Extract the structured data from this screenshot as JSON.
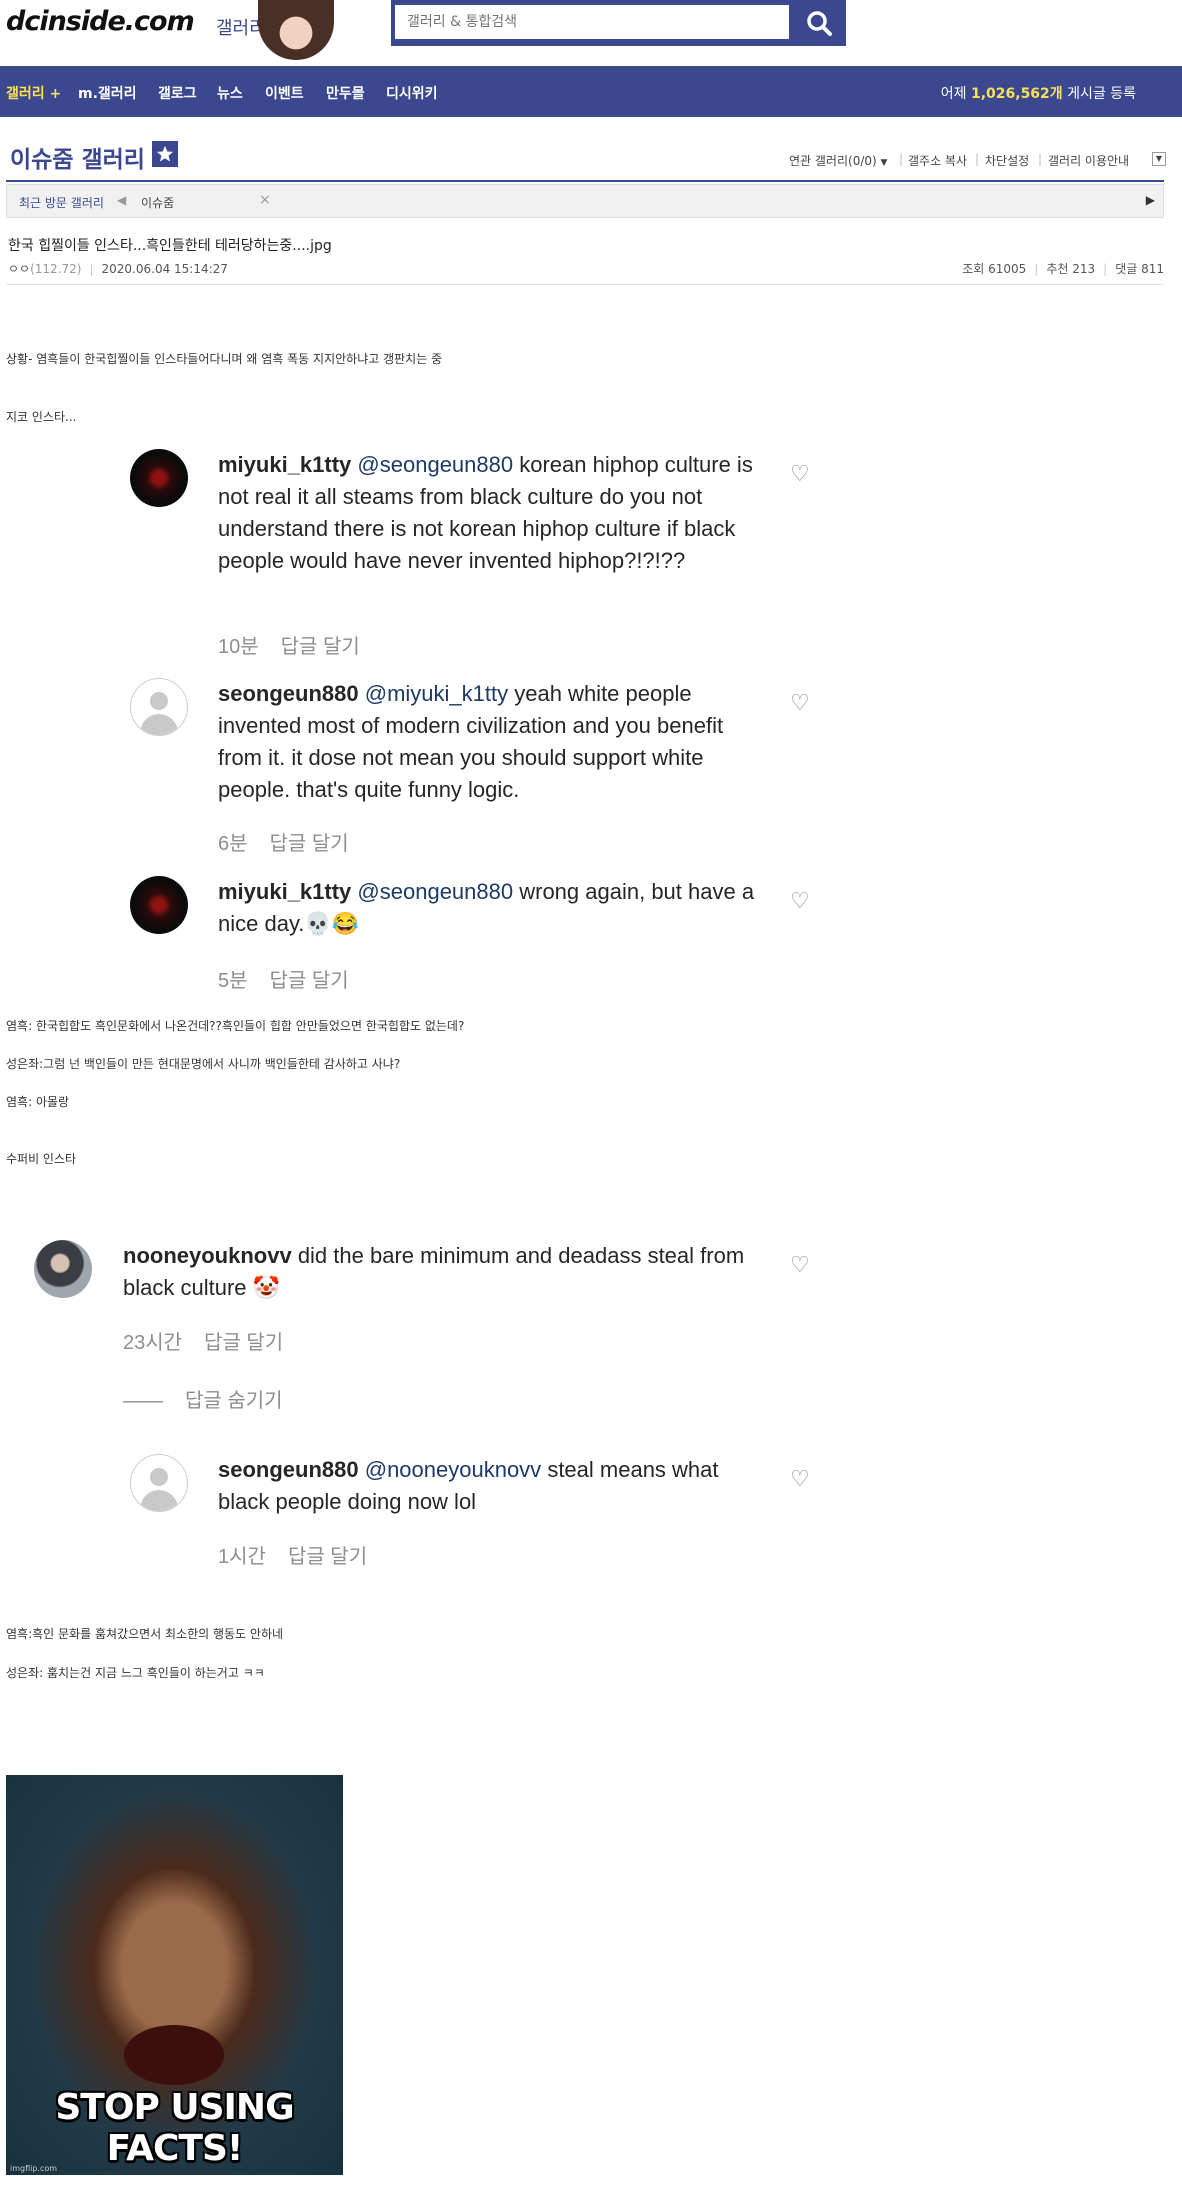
{
  "header": {
    "logo": "dcinside.com",
    "logo_sub": "갤러리",
    "search_placeholder": "갤러리 & 통합검색"
  },
  "nav": {
    "items": [
      "갤러리 +",
      "m.갤러리",
      "갤로그",
      "뉴스",
      "이벤트",
      "만두몰",
      "디시위키"
    ],
    "stat_prefix": "어제",
    "stat_value": "1,026,562개",
    "stat_suffix": "게시글 등록"
  },
  "gallery": {
    "title": "이슈줌 갤러리",
    "utils": [
      "연관 갤러리(0/0)",
      "갤주소 복사",
      "차단설정",
      "갤러리 이용안내"
    ],
    "recent_label": "최근 방문 갤러리",
    "recent_item": "이슈줌"
  },
  "post": {
    "title": "한국 힙찔이들 인스타...흑인들한테 테러당하는중....jpg",
    "author": "ㅇㅇ",
    "ip": "(112.72)",
    "date": "2020.06.04 15:14:27",
    "views": "조회 61005",
    "recommend": "추천 213",
    "comments": "댓글 811"
  },
  "body": {
    "situation": "상황- 염흑들이 한국힙찔이들 인스타들어다니며 왜 염흑 폭동 지지안하냐고 갱판치는 중",
    "jiko": "지코 인스타...",
    "line1": "염흑: 한국힙합도 흑인문화에서 나온건데??흑인들이 힙합 안만들었으면 한국힙합도 없는데?",
    "line2": "성은좌:그럼 넌 백인들이 만든 현대문명에서 사니까 백인들한테 감사하고 사냐?",
    "line3": "염흑: 아몰랑",
    "supervee": "수퍼비 인스타",
    "line4": "염흑:흑인 문화를 훔쳐갔으면서 최소한의 행동도 안하네",
    "line5": "성은좌: 훔치는건 지금 느그 흑인들이 하는거고 ㅋㅋ"
  },
  "comments": [
    {
      "user": "miyuki_k1tty",
      "mention": "@seongeun880",
      "text": "korean hiphop culture is not real it all steams from black culture do you not understand there is not korean hiphop culture if black people would have never invented hiphop?!?!??",
      "time": "10분",
      "reply": "답글 달기"
    },
    {
      "user": "seongeun880",
      "mention": "@miyuki_k1tty",
      "text": "yeah white people invented most of modern civilization and you benefit from it. it dose not mean you should support white people. that's quite funny logic.",
      "time": "6분",
      "reply": "답글 달기"
    },
    {
      "user": "miyuki_k1tty",
      "mention": "@seongeun880",
      "text": "wrong again, but have a nice day.💀😂",
      "time": "5분",
      "reply": "답글 달기"
    },
    {
      "user": "nooneyouknovv",
      "mention": "",
      "text": "did the bare minimum and deadass steal from black culture 🤡",
      "time": "23시간",
      "reply": "답글 달기",
      "hide_replies": "답글 숨기기"
    },
    {
      "user": "seongeun880",
      "mention": "@nooneyouknovv",
      "text": "steal means what black people doing now lol",
      "time": "1시간",
      "reply": "답글 달기"
    }
  ],
  "meme": {
    "caption": "STOP USING FACTS!",
    "credit": "imgflip.com"
  }
}
